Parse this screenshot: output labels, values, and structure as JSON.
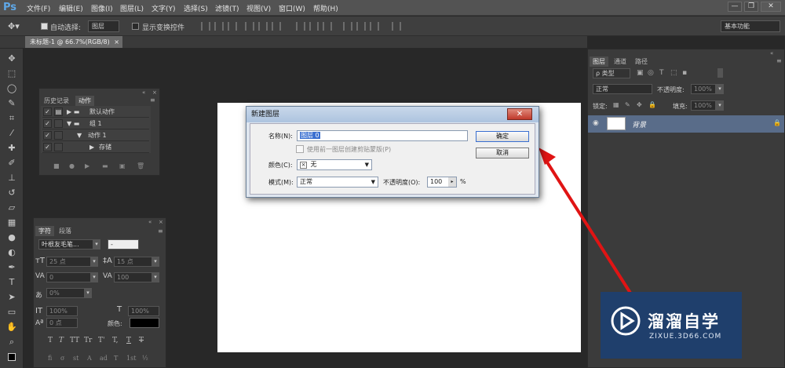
{
  "app": {
    "logo": "Ps"
  },
  "menu": [
    "文件(F)",
    "编辑(E)",
    "图像(I)",
    "图层(L)",
    "文字(Y)",
    "选择(S)",
    "滤镜(T)",
    "视图(V)",
    "窗口(W)",
    "帮助(H)"
  ],
  "window_controls": {
    "minimize": "—",
    "restore": "❐",
    "close": "✕"
  },
  "options_bar": {
    "auto_select_label": "自动选择:",
    "auto_select_value": "图层",
    "transform_label": "显示变换控件",
    "workspace": "基本功能"
  },
  "document_tab": {
    "label": "未标题-1 @ 66.7%(RGB/8)",
    "close": "×"
  },
  "history_panel": {
    "tabs": [
      "历史记录",
      "动作"
    ],
    "rows": [
      {
        "label": "默认动作",
        "indent": 0
      },
      {
        "label": "组 1",
        "indent": 0
      },
      {
        "label": "动作 1",
        "indent": 1
      },
      {
        "label": "存储",
        "indent": 2
      }
    ]
  },
  "character_panel": {
    "tabs": [
      "字符",
      "段落"
    ],
    "font_family": "叶根友毛笔...",
    "font_style": "-",
    "font_size": "25 点",
    "leading": "15 点",
    "kerning": "0",
    "tracking": "100",
    "scale_percent": "0%",
    "vertical_scale": "100%",
    "horizontal_scale": "100%",
    "baseline": "0 点",
    "color_label": "颜色:",
    "style_buttons": [
      "T",
      "T",
      "TT",
      "Tr",
      "T'",
      "T,",
      "T",
      "T"
    ],
    "feature_buttons": [
      "fi",
      "σ",
      "st",
      "A",
      "ad",
      "T",
      "1st",
      "½"
    ]
  },
  "layers_panel": {
    "tabs": [
      "图层",
      "通道",
      "路径"
    ],
    "filter_label": "ρ 类型",
    "blend_mode": "正常",
    "opacity_label": "不透明度:",
    "opacity_value": "100%",
    "lock_label": "锁定:",
    "fill_label": "填充:",
    "fill_value": "100%",
    "layer_name": "背景"
  },
  "dialog": {
    "title": "新建图层",
    "name_label": "名称(N):",
    "name_value": "图层 0",
    "clip_label": "使用前一图层创建剪贴蒙版(P)",
    "color_label": "颜色(C):",
    "color_value": "无",
    "mode_label": "模式(M):",
    "mode_value": "正常",
    "opacity_label": "不透明度(O):",
    "opacity_value": "100",
    "opacity_unit": "%",
    "ok_label": "确定",
    "cancel_label": "取消"
  },
  "watermark": {
    "title": "溜溜自学",
    "url": "ZIXUE.3D66.COM"
  },
  "colors": {
    "accent_red": "#e01414",
    "ps_blue": "#5fa8e8",
    "watermark_bg": "#1f3f6c"
  }
}
